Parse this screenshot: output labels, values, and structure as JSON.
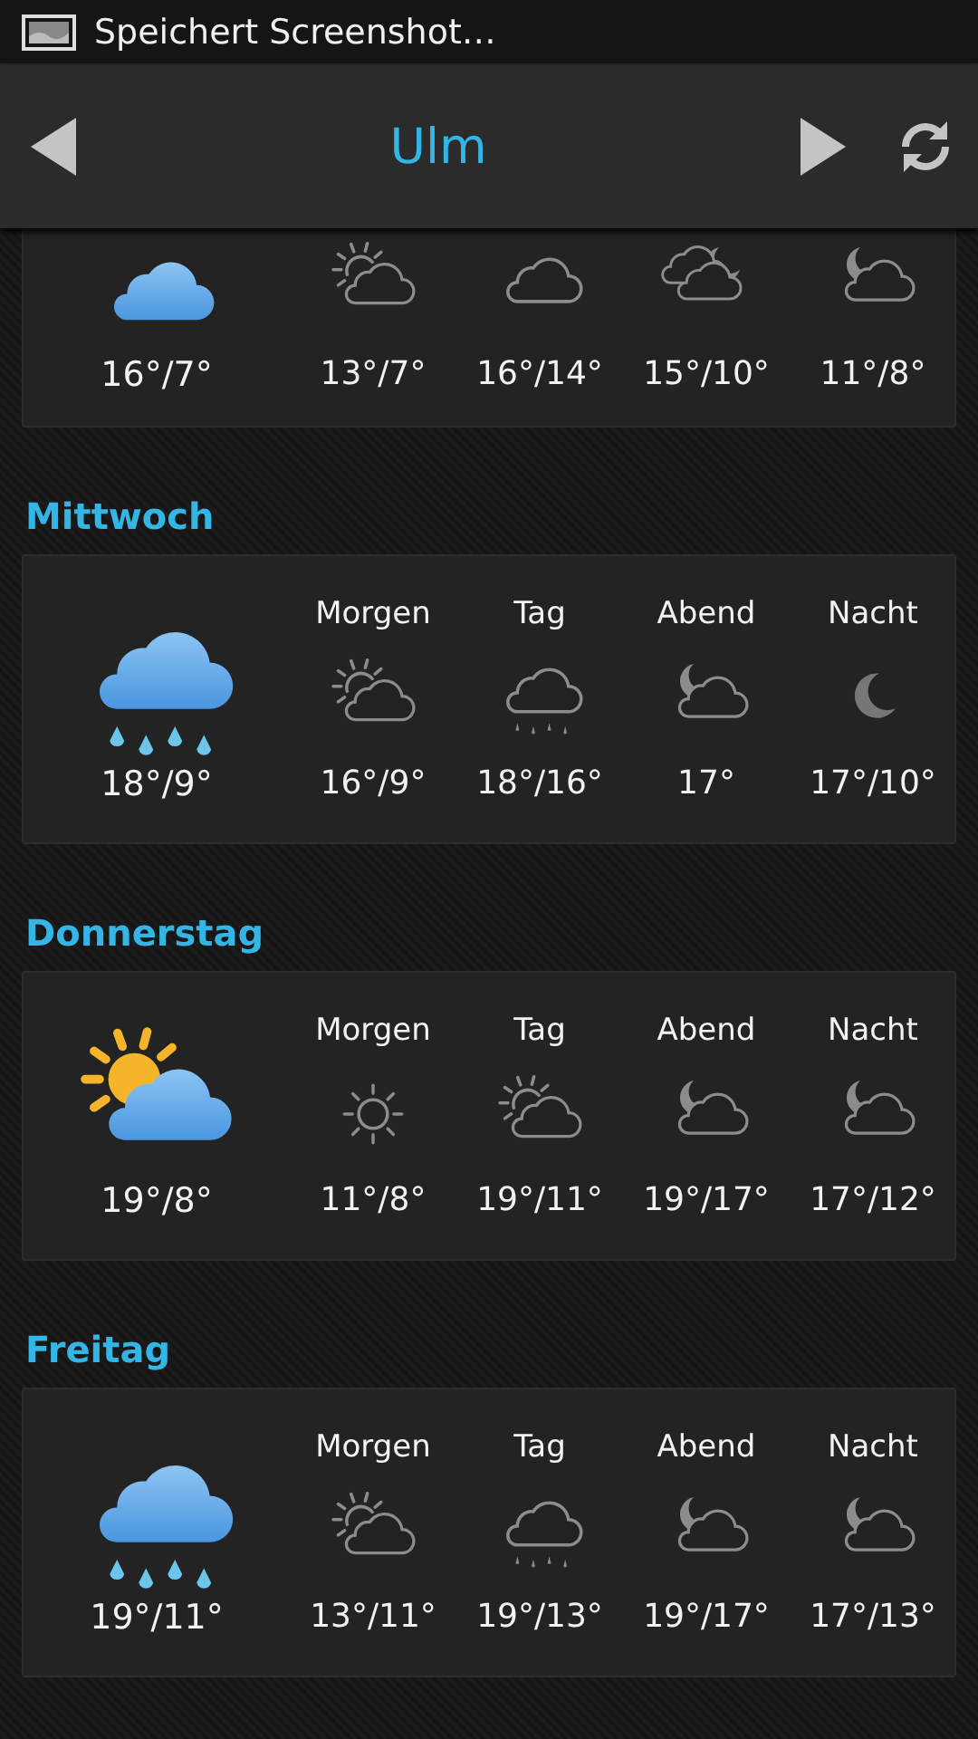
{
  "status_bar": {
    "notification": "Speichert Screenshot…"
  },
  "header": {
    "city": "Ulm"
  },
  "days": [
    {
      "kind": "cloud",
      "temps": "16°/7°",
      "periods": [
        {
          "kind": "partly-sunny",
          "temps": "13°/7°"
        },
        {
          "kind": "cloud",
          "temps": "16°/14°"
        },
        {
          "kind": "partly-cloudy-night",
          "temps": "15°/10°"
        },
        {
          "kind": "cloud-night",
          "temps": "11°/8°"
        }
      ]
    },
    {
      "name": "Mittwoch",
      "kind": "rain",
      "temps": "18°/9°",
      "periods": [
        {
          "label": "Morgen",
          "kind": "partly-sunny",
          "temps": "16°/9°"
        },
        {
          "label": "Tag",
          "kind": "rain",
          "temps": "18°/16°"
        },
        {
          "label": "Abend",
          "kind": "cloud-night",
          "temps": "17°"
        },
        {
          "label": "Nacht",
          "kind": "moon",
          "temps": "17°/10°"
        }
      ]
    },
    {
      "name": "Donnerstag",
      "kind": "partly-sunny",
      "temps": "19°/8°",
      "periods": [
        {
          "label": "Morgen",
          "kind": "sun",
          "temps": "11°/8°"
        },
        {
          "label": "Tag",
          "kind": "partly-sunny",
          "temps": "19°/11°"
        },
        {
          "label": "Abend",
          "kind": "cloud-night",
          "temps": "19°/17°"
        },
        {
          "label": "Nacht",
          "kind": "cloud-night",
          "temps": "17°/12°"
        }
      ]
    },
    {
      "name": "Freitag",
      "kind": "rain",
      "temps": "19°/11°",
      "periods": [
        {
          "label": "Morgen",
          "kind": "partly-sunny",
          "temps": "13°/11°"
        },
        {
          "label": "Tag",
          "kind": "rain",
          "temps": "19°/13°"
        },
        {
          "label": "Abend",
          "kind": "cloud-night",
          "temps": "19°/17°"
        },
        {
          "label": "Nacht",
          "kind": "cloud-night",
          "temps": "17°/13°"
        }
      ]
    }
  ]
}
